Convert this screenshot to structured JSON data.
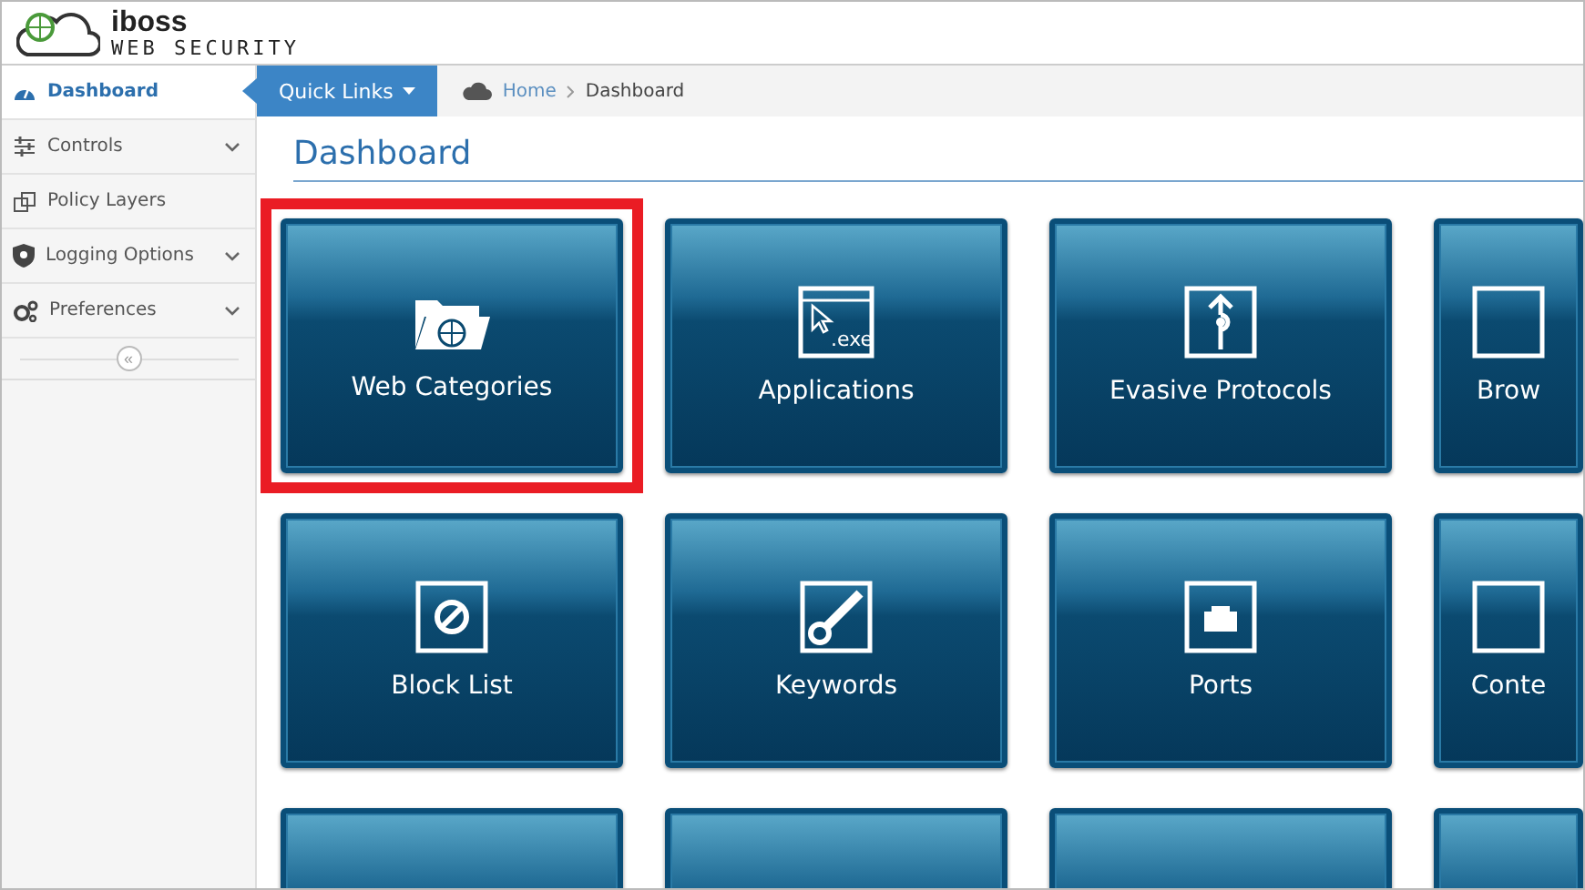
{
  "brand": {
    "name": "iboss",
    "subtitle": "WEB SECURITY"
  },
  "sidebar": {
    "items": [
      {
        "label": "Dashboard",
        "selected": true,
        "expandable": false
      },
      {
        "label": "Controls",
        "selected": false,
        "expandable": true
      },
      {
        "label": "Policy Layers",
        "selected": false,
        "expandable": false
      },
      {
        "label": "Logging Options",
        "selected": false,
        "expandable": true
      },
      {
        "label": "Preferences",
        "selected": false,
        "expandable": true
      }
    ],
    "collapse": "«"
  },
  "toolbar": {
    "quick_links": "Quick Links",
    "breadcrumb": [
      "Home",
      "Dashboard"
    ]
  },
  "page_title": "Dashboard",
  "tiles": [
    {
      "label": "Web Categories",
      "kind": "folder",
      "highlighted": true
    },
    {
      "label": "Applications",
      "kind": "exe",
      "icon_text": ".exe",
      "highlighted": false
    },
    {
      "label": "Evasive Protocols",
      "kind": "evasive",
      "highlighted": false
    },
    {
      "label": "Brow",
      "kind": "frame",
      "highlighted": false
    },
    {
      "label": "Block List",
      "kind": "block",
      "highlighted": false
    },
    {
      "label": "Keywords",
      "kind": "key",
      "highlighted": false
    },
    {
      "label": "Ports",
      "kind": "port",
      "highlighted": false
    },
    {
      "label": "Conte",
      "kind": "frame",
      "highlighted": false
    },
    {
      "kind": "frame",
      "highlighted": false
    },
    {
      "kind": "frame",
      "highlighted": false
    },
    {
      "kind": "frame",
      "highlighted": false
    },
    {
      "kind": "frame",
      "highlighted": false
    }
  ]
}
